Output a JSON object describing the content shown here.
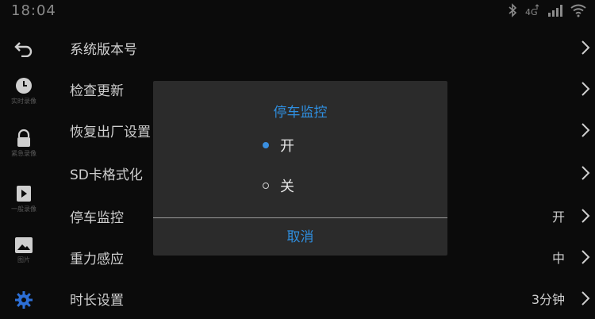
{
  "status_bar": {
    "time": "18:04",
    "icons": [
      "bluetooth-icon",
      "4g-icon",
      "signal-icon",
      "wifi-icon"
    ],
    "network_label": "4G"
  },
  "rail": {
    "items": [
      {
        "icon": "back-icon",
        "label": ""
      },
      {
        "icon": "clock-icon",
        "label": "实时录像"
      },
      {
        "icon": "lock-icon",
        "label": "紧急录像"
      },
      {
        "icon": "play-icon",
        "label": "一般录像"
      },
      {
        "icon": "picture-icon",
        "label": "图片"
      },
      {
        "icon": "gear-icon",
        "label": ""
      }
    ]
  },
  "settings": {
    "rows": [
      {
        "label": "系统版本号",
        "value": ""
      },
      {
        "label": "检查更新",
        "value": ""
      },
      {
        "label": "恢复出厂设置",
        "value": ""
      },
      {
        "label": "SD卡格式化",
        "value": ""
      },
      {
        "label": "停车监控",
        "value": "开"
      },
      {
        "label": "重力感应",
        "value": "中"
      },
      {
        "label": "时长设置",
        "value": "3分钟"
      }
    ]
  },
  "dialog": {
    "title": "停车监控",
    "options": [
      {
        "label": "开",
        "selected": true
      },
      {
        "label": "关",
        "selected": false
      }
    ],
    "cancel_label": "取消"
  },
  "colors": {
    "background": "#0b0b0b",
    "dialog_bg": "#2b2b2b",
    "accent": "#2f8fe0",
    "active_rail_icon": "#2d6fd6"
  }
}
